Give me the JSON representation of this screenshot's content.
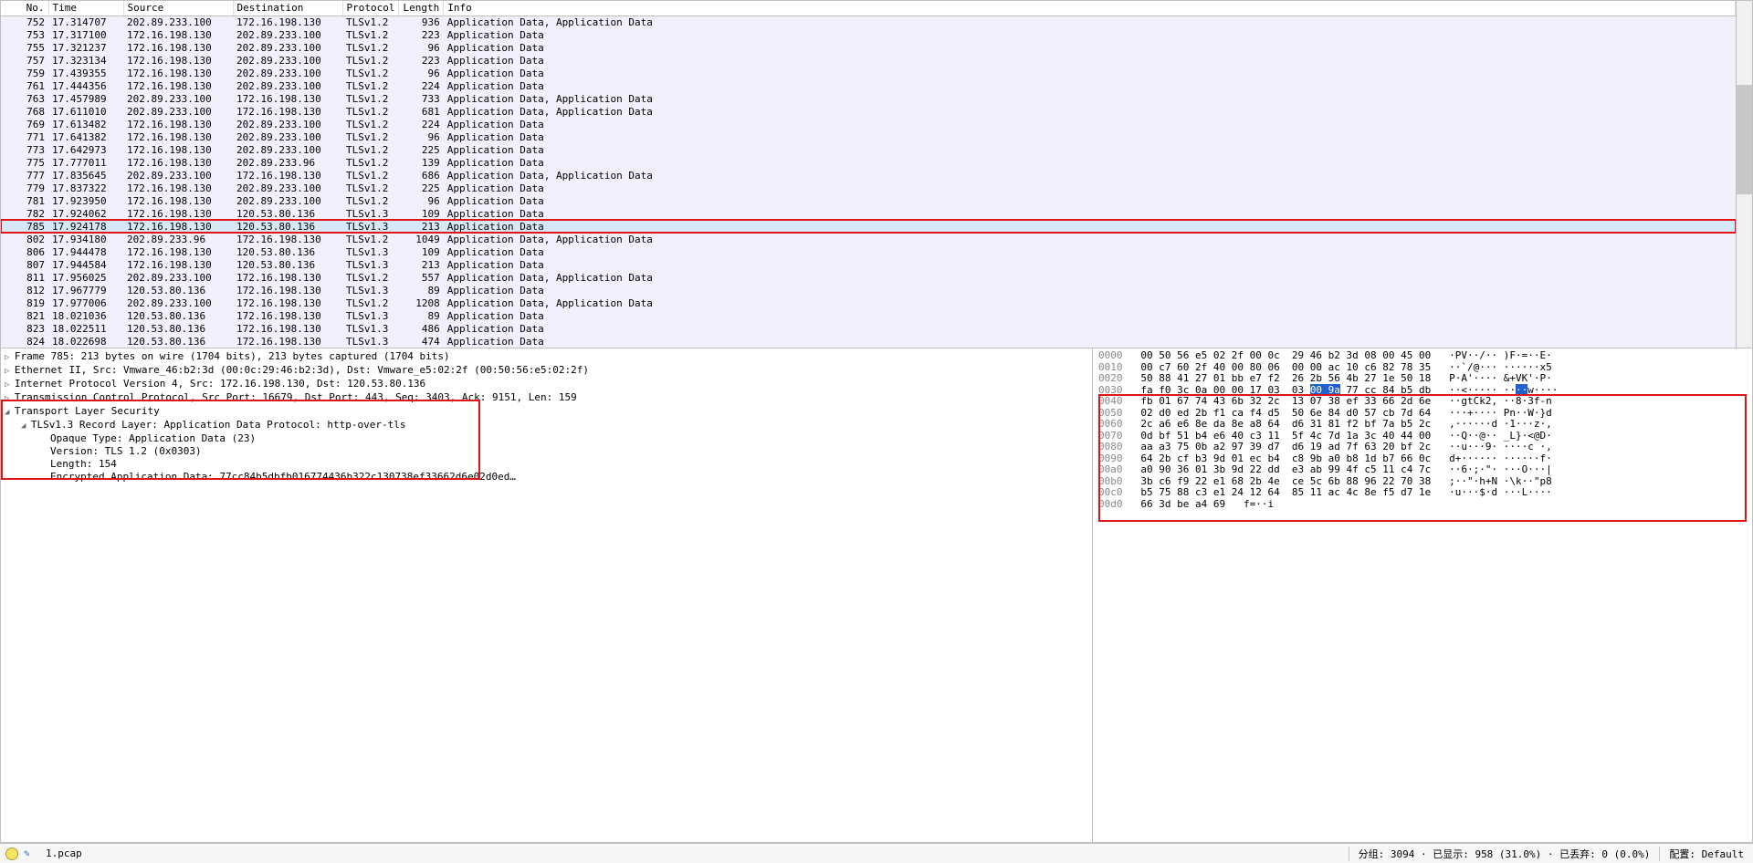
{
  "columns": {
    "no": "No.",
    "time": "Time",
    "src": "Source",
    "dst": "Destination",
    "proto": "Protocol",
    "len": "Length",
    "info": "Info"
  },
  "selected_no": 785,
  "packets": [
    {
      "no": 752,
      "time": "17.314707",
      "src": "202.89.233.100",
      "dst": "172.16.198.130",
      "proto": "TLSv1.2",
      "len": 936,
      "info": "Application Data, Application Data"
    },
    {
      "no": 753,
      "time": "17.317100",
      "src": "172.16.198.130",
      "dst": "202.89.233.100",
      "proto": "TLSv1.2",
      "len": 223,
      "info": "Application Data"
    },
    {
      "no": 755,
      "time": "17.321237",
      "src": "172.16.198.130",
      "dst": "202.89.233.100",
      "proto": "TLSv1.2",
      "len": 96,
      "info": "Application Data"
    },
    {
      "no": 757,
      "time": "17.323134",
      "src": "172.16.198.130",
      "dst": "202.89.233.100",
      "proto": "TLSv1.2",
      "len": 223,
      "info": "Application Data"
    },
    {
      "no": 759,
      "time": "17.439355",
      "src": "172.16.198.130",
      "dst": "202.89.233.100",
      "proto": "TLSv1.2",
      "len": 96,
      "info": "Application Data"
    },
    {
      "no": 761,
      "time": "17.444356",
      "src": "172.16.198.130",
      "dst": "202.89.233.100",
      "proto": "TLSv1.2",
      "len": 224,
      "info": "Application Data"
    },
    {
      "no": 763,
      "time": "17.457989",
      "src": "202.89.233.100",
      "dst": "172.16.198.130",
      "proto": "TLSv1.2",
      "len": 733,
      "info": "Application Data, Application Data"
    },
    {
      "no": 768,
      "time": "17.611010",
      "src": "202.89.233.100",
      "dst": "172.16.198.130",
      "proto": "TLSv1.2",
      "len": 681,
      "info": "Application Data, Application Data"
    },
    {
      "no": 769,
      "time": "17.613482",
      "src": "172.16.198.130",
      "dst": "202.89.233.100",
      "proto": "TLSv1.2",
      "len": 224,
      "info": "Application Data"
    },
    {
      "no": 771,
      "time": "17.641382",
      "src": "172.16.198.130",
      "dst": "202.89.233.100",
      "proto": "TLSv1.2",
      "len": 96,
      "info": "Application Data"
    },
    {
      "no": 773,
      "time": "17.642973",
      "src": "172.16.198.130",
      "dst": "202.89.233.100",
      "proto": "TLSv1.2",
      "len": 225,
      "info": "Application Data"
    },
    {
      "no": 775,
      "time": "17.777011",
      "src": "172.16.198.130",
      "dst": "202.89.233.96",
      "proto": "TLSv1.2",
      "len": 139,
      "info": "Application Data"
    },
    {
      "no": 777,
      "time": "17.835645",
      "src": "202.89.233.100",
      "dst": "172.16.198.130",
      "proto": "TLSv1.2",
      "len": 686,
      "info": "Application Data, Application Data"
    },
    {
      "no": 779,
      "time": "17.837322",
      "src": "172.16.198.130",
      "dst": "202.89.233.100",
      "proto": "TLSv1.2",
      "len": 225,
      "info": "Application Data"
    },
    {
      "no": 781,
      "time": "17.923950",
      "src": "172.16.198.130",
      "dst": "202.89.233.100",
      "proto": "TLSv1.2",
      "len": 96,
      "info": "Application Data"
    },
    {
      "no": 782,
      "time": "17.924062",
      "src": "172.16.198.130",
      "dst": "120.53.80.136",
      "proto": "TLSv1.3",
      "len": 109,
      "info": "Application Data"
    },
    {
      "no": 785,
      "time": "17.924178",
      "src": "172.16.198.130",
      "dst": "120.53.80.136",
      "proto": "TLSv1.3",
      "len": 213,
      "info": "Application Data"
    },
    {
      "no": 802,
      "time": "17.934180",
      "src": "202.89.233.96",
      "dst": "172.16.198.130",
      "proto": "TLSv1.2",
      "len": 1049,
      "info": "Application Data, Application Data"
    },
    {
      "no": 806,
      "time": "17.944478",
      "src": "172.16.198.130",
      "dst": "120.53.80.136",
      "proto": "TLSv1.3",
      "len": 109,
      "info": "Application Data"
    },
    {
      "no": 807,
      "time": "17.944584",
      "src": "172.16.198.130",
      "dst": "120.53.80.136",
      "proto": "TLSv1.3",
      "len": 213,
      "info": "Application Data"
    },
    {
      "no": 811,
      "time": "17.956025",
      "src": "202.89.233.100",
      "dst": "172.16.198.130",
      "proto": "TLSv1.2",
      "len": 557,
      "info": "Application Data, Application Data"
    },
    {
      "no": 812,
      "time": "17.967779",
      "src": "120.53.80.136",
      "dst": "172.16.198.130",
      "proto": "TLSv1.3",
      "len": 89,
      "info": "Application Data"
    },
    {
      "no": 819,
      "time": "17.977006",
      "src": "202.89.233.100",
      "dst": "172.16.198.130",
      "proto": "TLSv1.2",
      "len": 1208,
      "info": "Application Data, Application Data"
    },
    {
      "no": 821,
      "time": "18.021036",
      "src": "120.53.80.136",
      "dst": "172.16.198.130",
      "proto": "TLSv1.3",
      "len": 89,
      "info": "Application Data"
    },
    {
      "no": 823,
      "time": "18.022511",
      "src": "120.53.80.136",
      "dst": "172.16.198.130",
      "proto": "TLSv1.3",
      "len": 486,
      "info": "Application Data"
    },
    {
      "no": 824,
      "time": "18.022698",
      "src": "120.53.80.136",
      "dst": "172.16.198.130",
      "proto": "TLSv1.3",
      "len": 474,
      "info": "Application Data"
    }
  ],
  "tree": {
    "frame": "Frame 785: 213 bytes on wire (1704 bits), 213 bytes captured (1704 bits)",
    "eth": "Ethernet II, Src: Vmware_46:b2:3d (00:0c:29:46:b2:3d), Dst: Vmware_e5:02:2f (00:50:56:e5:02:2f)",
    "ip": "Internet Protocol Version 4, Src: 172.16.198.130, Dst: 120.53.80.136",
    "tcp": "Transmission Control Protocol, Src Port: 16679, Dst Port: 443, Seq: 3403, Ack: 9151, Len: 159",
    "tls": "Transport Layer Security",
    "rec": "TLSv1.3 Record Layer: Application Data Protocol: http-over-tls",
    "opq": "Opaque Type: Application Data (23)",
    "ver": "Version: TLS 1.2 (0x0303)",
    "ln": "Length: 154",
    "enc": "Encrypted Application Data: 77cc84b5dbfb016774436b322c130738ef33662d6e02d0ed…"
  },
  "hex": [
    {
      "off": "0000",
      "b": "00 50 56 e5 02 2f 00 0c  29 46 b2 3d 08 00 45 00",
      "a": "·PV··/·· )F·=··E·"
    },
    {
      "off": "0010",
      "b": "00 c7 60 2f 40 00 80 06  00 00 ac 10 c6 82 78 35",
      "a": "··`/@··· ······x5"
    },
    {
      "off": "0020",
      "b": "50 88 41 27 01 bb e7 f2  26 2b 56 4b 27 1e 50 18",
      "a": "P·A'···· &+VK'·P·"
    },
    {
      "off": "0030",
      "b": "fa f0 3c 0a 00 00 17 03  03 ",
      "sel": "00 9a",
      "b2": " 77 cc 84 b5 db",
      "a": "··<····· ··",
      "asel": "··",
      "a2": "w····"
    },
    {
      "off": "0040",
      "b": "fb 01 67 74 43 6b 32 2c  13 07 38 ef 33 66 2d 6e",
      "a": "··gtCk2, ··8·3f-n"
    },
    {
      "off": "0050",
      "b": "02 d0 ed 2b f1 ca f4 d5  50 6e 84 d0 57 cb 7d 64",
      "a": "···+···· Pn··W·}d"
    },
    {
      "off": "0060",
      "b": "2c a6 e6 8e da 8e a8 64  d6 31 81 f2 bf 7a b5 2c",
      "a": ",······d ·1···z·,"
    },
    {
      "off": "0070",
      "b": "0d bf 51 b4 e6 40 c3 11  5f 4c 7d 1a 3c 40 44 00",
      "a": "··Q··@·· _L}·<@D·"
    },
    {
      "off": "0080",
      "b": "aa a3 75 0b a2 97 39 d7  d6 19 ad 7f 63 20 bf 2c",
      "a": "··u···9· ····c ·,"
    },
    {
      "off": "0090",
      "b": "64 2b cf b3 9d 01 ec b4  c8 9b a0 b8 1d b7 66 0c",
      "a": "d+······ ······f·"
    },
    {
      "off": "00a0",
      "b": "a0 90 36 01 3b 9d 22 dd  e3 ab 99 4f c5 11 c4 7c",
      "a": "··6·;·\"· ···O···|"
    },
    {
      "off": "00b0",
      "b": "3b c6 f9 22 e1 68 2b 4e  ce 5c 6b 88 96 22 70 38",
      "a": ";··\"·h+N ·\\k··\"p8"
    },
    {
      "off": "00c0",
      "b": "b5 75 88 c3 e1 24 12 64  85 11 ac 4c 8e f5 d7 1e",
      "a": "·u···$·d ···L····"
    },
    {
      "off": "00d0",
      "b": "66 3d be a4 69",
      "a": "f=··i"
    }
  ],
  "status": {
    "file": "1.pcap",
    "pkts": "分组: 3094 · 已显示: 958 (31.0%) · 已丢弃: 0 (0.0%)",
    "prof": "配置: Default"
  }
}
